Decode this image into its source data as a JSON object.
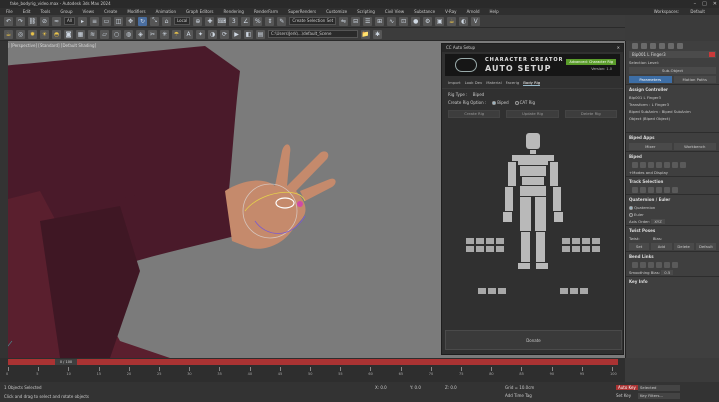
{
  "window": {
    "title": "fake_bodyrig_video.max - Autodesk 3ds Max 2024"
  },
  "menu": [
    "File",
    "Edit",
    "Tools",
    "Group",
    "Views",
    "Create",
    "Modifiers",
    "Animation",
    "Graph Editors",
    "Rendering",
    "RenderFarm",
    "SuperRenders",
    "Customize",
    "Scripting",
    "Civil View",
    "Substance",
    "V-Ray",
    "Arnold",
    "Help"
  ],
  "workspace": {
    "label": "Workspaces:",
    "value": "Default"
  },
  "toolbar": {
    "selection_filter": "All",
    "ref_coord": "Local",
    "selection_set": "Create Selection Set"
  },
  "toolbar2": {
    "path": "C:\\Users\\Jerk\\...\\default_Scene"
  },
  "viewport": {
    "label": "[+] [Perspective] [Standard] [Default Shading]"
  },
  "dialog": {
    "title": "CC Auto Setup",
    "banner_line1": "CHARACTER CREATOR",
    "banner_line2": "AUTO SETUP",
    "banner_badge": "Advanced: Character Rig",
    "version": "Version: 1.0",
    "tabs": [
      "Import",
      "Look Dev",
      "Material",
      "Facerig",
      "Body Rig"
    ],
    "active_tab": "Body Rig",
    "rig_type_label": "Rig Type :",
    "rig_type_value": "Biped",
    "rig_option_label": "Create Rig Option :",
    "rig_option_biped": "Biped",
    "rig_option_cat": "CAT Rig",
    "buttons": [
      "Create Rig",
      "Update Rig",
      "Delete Rig"
    ],
    "donate": "Donate"
  },
  "command_panel": {
    "object_name": "Bip001 L Finger3",
    "selection_level": "Selection Level:",
    "sub_object": "Sub-Object",
    "tabs": [
      "Parameters",
      "Motion Paths"
    ],
    "assign_controller": "Assign Controller",
    "ctrl_lines": [
      "Bip001 L Finger3",
      "Transform : L Finger3",
      "Biped SubAnim : Biped SubAnim",
      "Object (Biped Object)"
    ],
    "biped_apps": "Biped Apps",
    "mixer": "Mixer",
    "workbench": "Workbench",
    "biped": "Biped",
    "modes": "+Modes and Display",
    "track_selection": "Track Selection",
    "quaternion": "Quaternion / Euler",
    "quat_opt": "Quaternion",
    "euler_opt": "Euler",
    "axis_order": "Axis Order:",
    "axis_value": "XYZ",
    "twist_poses": "Twist Poses",
    "twist": "Twist:",
    "bias": "Bias:",
    "twist_btns": [
      "Set",
      "Add",
      "Delete",
      "Default"
    ],
    "bend_links": "Bend Links",
    "smoothing": "Smoothing Bias:",
    "smoothing_value": "0.5",
    "key_info": "Key Info"
  },
  "timeline": {
    "frame": "0 / 100",
    "ticks": [
      "0",
      "5",
      "10",
      "15",
      "20",
      "25",
      "30",
      "35",
      "40",
      "45",
      "50",
      "55",
      "60",
      "65",
      "70",
      "75",
      "80",
      "85",
      "90",
      "95",
      "100"
    ]
  },
  "status": {
    "line1": "1 Objects Selected",
    "line2": "Click and drag to select and rotate objects",
    "x": "X: 0.0",
    "y": "Y: 0.0",
    "z": "Z: 0.0",
    "grid": "Grid = 10.0cm",
    "add_time_tag": "Add Time Tag",
    "auto_key": "Auto Key",
    "set_key": "Set Key",
    "selected": "Selected",
    "key_filters": "Key Filters..."
  },
  "colors": {
    "accent": "#3d6ea6",
    "timeline_red": "#aa3333",
    "banner_green": "#5a9c2a"
  }
}
